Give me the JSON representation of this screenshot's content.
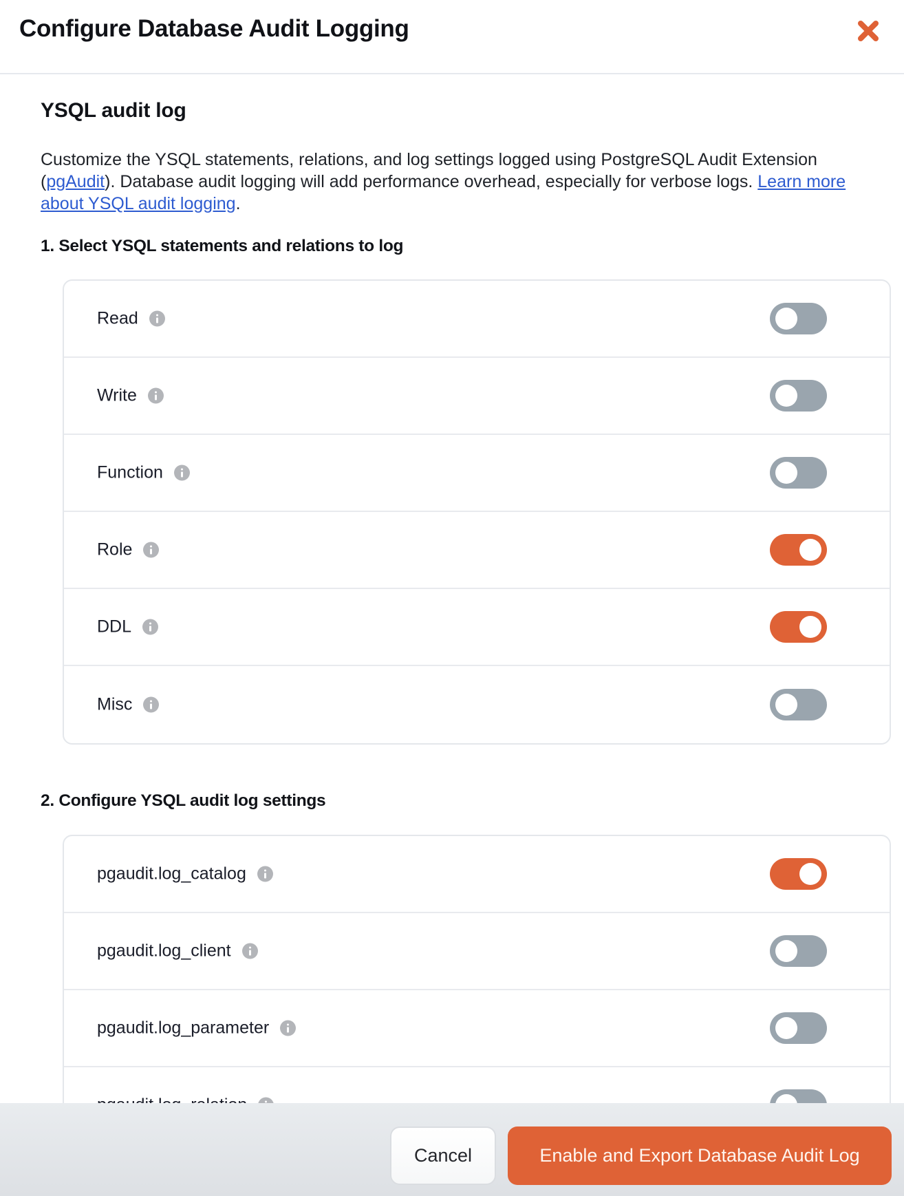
{
  "header": {
    "title": "Configure Database Audit Logging",
    "close_icon": "close-x-icon",
    "accent_color": "#DF6236"
  },
  "body": {
    "section_title": "YSQL audit log",
    "description": {
      "part1": "Customize the YSQL statements, relations, and log settings logged using PostgreSQL Audit Extension (",
      "link1": "pgAudit",
      "part2": "). Database audit logging will add performance overhead, especially for verbose logs. ",
      "link2": "Learn more about YSQL audit logging",
      "part3": "."
    },
    "step1": {
      "heading": "1. Select YSQL statements and relations to log",
      "items": [
        {
          "label": "Read",
          "enabled": false
        },
        {
          "label": "Write",
          "enabled": false
        },
        {
          "label": "Function",
          "enabled": false
        },
        {
          "label": "Role",
          "enabled": true
        },
        {
          "label": "DDL",
          "enabled": true
        },
        {
          "label": "Misc",
          "enabled": false
        }
      ]
    },
    "step2": {
      "heading": "2. Configure YSQL audit log settings",
      "items": [
        {
          "label": "pgaudit.log_catalog",
          "enabled": true
        },
        {
          "label": "pgaudit.log_client",
          "enabled": false
        },
        {
          "label": "pgaudit.log_parameter",
          "enabled": false
        },
        {
          "label": "pgaudit.log_relation",
          "enabled": false
        }
      ]
    }
  },
  "footer": {
    "cancel_label": "Cancel",
    "primary_label": "Enable and Export Database Audit Log"
  },
  "colors": {
    "toggle_on": "#DF6236",
    "toggle_off": "#9AA5AE",
    "link": "#2D5BD0"
  }
}
